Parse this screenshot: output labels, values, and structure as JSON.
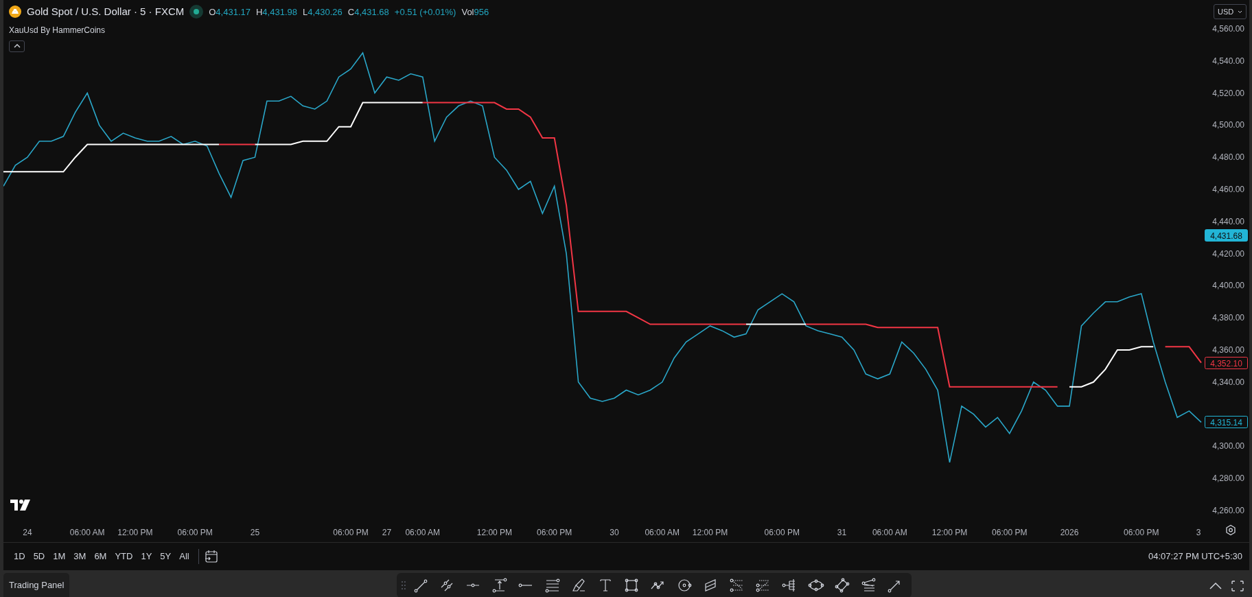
{
  "header": {
    "symbol": "Gold Spot / U.S. Dollar · 5 · FXCM",
    "market_open": true,
    "ohlc": [
      {
        "label": "O",
        "value": "4,431.17"
      },
      {
        "label": "H",
        "value": "4,431.98"
      },
      {
        "label": "L",
        "value": "4,430.26"
      },
      {
        "label": "C",
        "value": "4,431.68"
      }
    ],
    "change": "+0.51 (+0.01%)",
    "volume_label": "Vol",
    "volume": "956"
  },
  "indicator": "XauUsd By HammerCoins",
  "currency": "USD",
  "chart": {
    "chart_data": {
      "type": "line",
      "ylim": [
        4260,
        4560
      ],
      "categories": [
        null,
        null,
        "24",
        null,
        null,
        null,
        null,
        "06:00 AM",
        null,
        null,
        null,
        "12:00 PM",
        null,
        null,
        null,
        null,
        "06:00 PM",
        null,
        null,
        null,
        null,
        "25",
        null,
        null,
        null,
        null,
        null,
        null,
        null,
        "06:00 PM",
        null,
        null,
        "27",
        null,
        null,
        "06:00 AM",
        null,
        null,
        null,
        null,
        null,
        "12:00 PM",
        null,
        null,
        null,
        null,
        "06:00 PM",
        null,
        null,
        null,
        null,
        "30",
        null,
        null,
        null,
        "06:00 AM",
        null,
        null,
        null,
        "12:00 PM",
        null,
        null,
        null,
        null,
        null,
        "06:00 PM",
        null,
        null,
        null,
        null,
        "31",
        null,
        null,
        null,
        "06:00 AM",
        null,
        null,
        null,
        null,
        "12:00 PM",
        null,
        null,
        null,
        null,
        "06:00 PM",
        null,
        null,
        null,
        null,
        "2026",
        null,
        null,
        null,
        null,
        null,
        "06:00 PM",
        null,
        null,
        null,
        null,
        "3"
      ],
      "series": [
        {
          "color": "#2aa7c9",
          "values": [
            4462,
            4475,
            4480,
            4490,
            4490,
            4493,
            4508,
            4520,
            4500,
            4490,
            4495,
            4492,
            4490,
            4490,
            4493,
            4488,
            4490,
            4487,
            4470,
            4455,
            4478,
            4480,
            4515,
            4515,
            4518,
            4512,
            4510,
            4515,
            4530,
            4535,
            4545,
            4520,
            4530,
            4528,
            4532,
            4530,
            4490,
            4505,
            4512,
            4515,
            4512,
            4480,
            4472,
            4460,
            4465,
            4445,
            4462,
            4420,
            4340,
            4330,
            4328,
            4330,
            4335,
            4332,
            4335,
            4340,
            4355,
            4365,
            4370,
            4375,
            4372,
            4368,
            4370,
            4385,
            4390,
            4395,
            4390,
            4375,
            4372,
            4370,
            4368,
            4360,
            4345,
            4342,
            4345,
            4365,
            4358,
            4348,
            4335,
            4290,
            4325,
            4320,
            4312,
            4318,
            4308,
            4322,
            4340,
            4335,
            4325,
            4325,
            4375,
            4383,
            4390,
            4390,
            4393,
            4395,
            4365,
            4340,
            4318,
            4322,
            4315
          ]
        },
        {
          "color": "#ffffff",
          "values": [
            4471,
            4471,
            4471,
            4471,
            4471,
            4471,
            4480,
            4488,
            4488,
            4488,
            4488,
            4488,
            4488,
            4488,
            4488,
            4488,
            4488,
            4488,
            4488,
            null,
            null,
            4488,
            4488,
            4488,
            4488,
            4490,
            4490,
            4490,
            4499,
            4499,
            4514,
            4514,
            4514,
            4514,
            4514,
            4514,
            null,
            null,
            null,
            null,
            null,
            null,
            null,
            null,
            null,
            null,
            null,
            null,
            null,
            null,
            null,
            null,
            null,
            null,
            null,
            null,
            null,
            null,
            null,
            null,
            null,
            null,
            4376,
            4376,
            4376,
            4376,
            4376,
            4376,
            null,
            null,
            null,
            null,
            null,
            null,
            null,
            null,
            null,
            null,
            null,
            null,
            null,
            null,
            null,
            null,
            null,
            null,
            null,
            null,
            null,
            4337,
            4337,
            4340,
            4348,
            4360,
            4360,
            4362,
            4362,
            null,
            null,
            null,
            null
          ]
        },
        {
          "color": "#f23645",
          "values": [
            null,
            null,
            null,
            null,
            null,
            null,
            null,
            null,
            null,
            null,
            null,
            null,
            null,
            null,
            null,
            null,
            null,
            null,
            4488,
            4488,
            4488,
            4488,
            null,
            null,
            null,
            null,
            null,
            null,
            null,
            null,
            null,
            null,
            null,
            null,
            null,
            4514,
            4514,
            4514,
            4514,
            4514,
            4514,
            4514,
            4510,
            4510,
            4505,
            4492,
            4492,
            4450,
            4384,
            4384,
            4384,
            4384,
            4384,
            4380,
            4376,
            4376,
            4376,
            4376,
            4376,
            4376,
            4376,
            4376,
            4376,
            null,
            null,
            null,
            null,
            4376,
            4376,
            4376,
            4376,
            4376,
            4376,
            4374,
            4374,
            4374,
            4374,
            4374,
            4374,
            4337,
            4337,
            4337,
            4337,
            4337,
            4337,
            4337,
            4337,
            4337,
            4337,
            null,
            null,
            null,
            null,
            null,
            null,
            null,
            null,
            4362,
            4362,
            4362,
            4352
          ]
        }
      ],
      "yticks": [
        {
          "value": 4560,
          "label": "4,560.00"
        },
        {
          "value": 4540,
          "label": "4,540.00"
        },
        {
          "value": 4520,
          "label": "4,520.00"
        },
        {
          "value": 4500,
          "label": "4,500.00"
        },
        {
          "value": 4480,
          "label": "4,480.00"
        },
        {
          "value": 4460,
          "label": "4,460.00"
        },
        {
          "value": 4440,
          "label": "4,440.00"
        },
        {
          "value": 4420,
          "label": "4,420.00"
        },
        {
          "value": 4400,
          "label": "4,400.00"
        },
        {
          "value": 4380,
          "label": "4,380.00"
        },
        {
          "value": 4360,
          "label": "4,360.00"
        },
        {
          "value": 4340,
          "label": "4,340.00"
        },
        {
          "value": 4300,
          "label": "4,300.00"
        },
        {
          "value": 4280,
          "label": "4,280.00"
        },
        {
          "value": 4260,
          "label": "4,260.00"
        }
      ],
      "annotations": [
        "4,431.68",
        "4,352.10",
        "4,315.14"
      ]
    }
  },
  "ranges": [
    {
      "label": "1D"
    },
    {
      "label": "5D"
    },
    {
      "label": "1M"
    },
    {
      "label": "3M"
    },
    {
      "label": "6M"
    },
    {
      "label": "YTD"
    },
    {
      "label": "1Y"
    },
    {
      "label": "5Y"
    },
    {
      "label": "All"
    }
  ],
  "clock": "04:07:27 PM UTC+5:30",
  "trading_panel": "Trading Panel"
}
